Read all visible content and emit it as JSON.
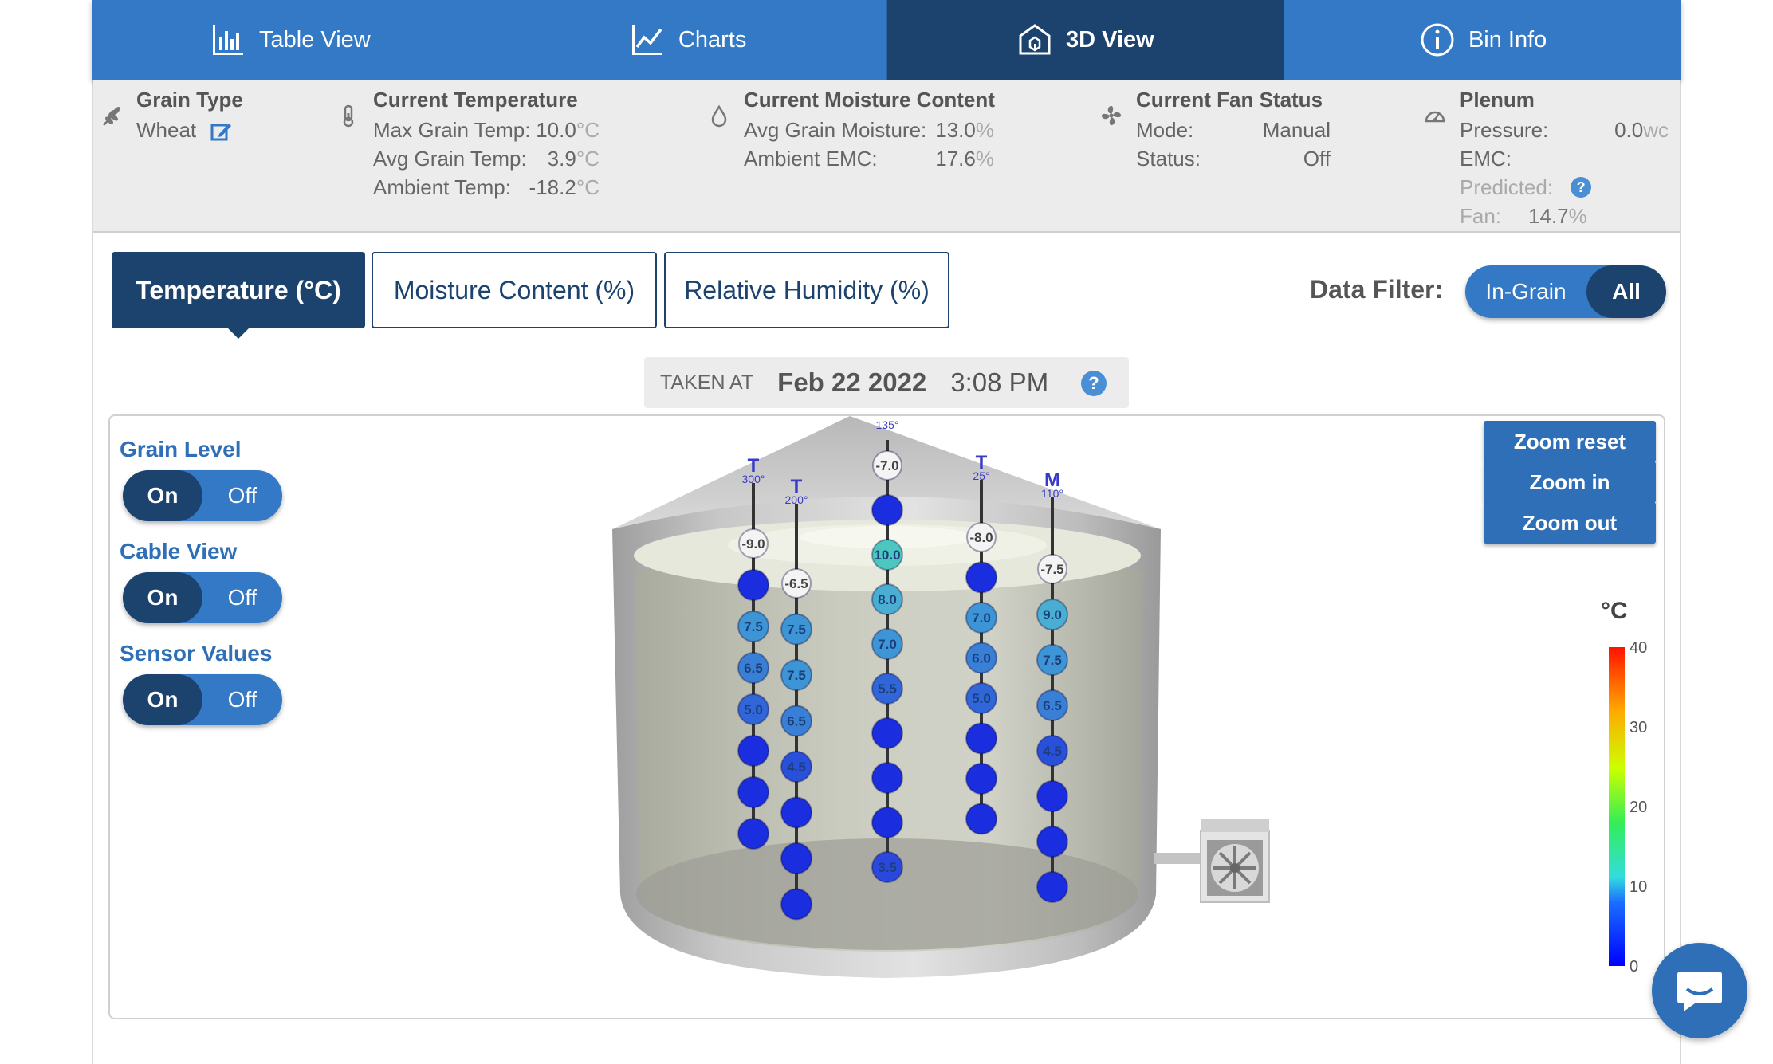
{
  "nav": [
    {
      "label": "Table View",
      "icon": "bar-chart-icon"
    },
    {
      "label": "Charts",
      "icon": "line-chart-icon"
    },
    {
      "label": "3D View",
      "icon": "bin-3d-icon",
      "active": true
    },
    {
      "label": "Bin Info",
      "icon": "info-icon"
    }
  ],
  "info": {
    "grain": {
      "title": "Grain Type",
      "value": "Wheat"
    },
    "temperature": {
      "title": "Current Temperature",
      "rows": [
        {
          "label": "Max Grain Temp:",
          "value": "10.0",
          "unit": "°C"
        },
        {
          "label": "Avg Grain Temp:",
          "value": "3.9",
          "unit": "°C"
        },
        {
          "label": "Ambient Temp:",
          "value": "-18.2",
          "unit": "°C"
        }
      ]
    },
    "moisture": {
      "title": "Current Moisture Content",
      "rows": [
        {
          "label": "Avg Grain Moisture:",
          "value": "13.0",
          "unit": "%"
        },
        {
          "label": "Ambient EMC:",
          "value": "17.6",
          "unit": "%"
        }
      ]
    },
    "fan": {
      "title": "Current Fan Status",
      "rows": [
        {
          "label": "Mode:",
          "value": "Manual"
        },
        {
          "label": "Status:",
          "value": "Off"
        }
      ]
    },
    "plenum": {
      "title": "Plenum",
      "pressure_label": "Pressure:",
      "pressure_value": "0.0",
      "pressure_unit": "wc",
      "emc_label": "EMC:",
      "predicted_label": "Predicted:",
      "fan_label": "Fan:",
      "fan_value": "14.7",
      "fan_unit": "%"
    }
  },
  "tabs": [
    {
      "label": "Temperature (°C)",
      "active": true
    },
    {
      "label": "Moisture Content (%)"
    },
    {
      "label": "Relative Humidity (%)"
    }
  ],
  "filter": {
    "label": "Data Filter:",
    "options": [
      "In-Grain",
      "All"
    ],
    "selected": "All"
  },
  "taken": {
    "label": "TAKEN AT",
    "date": "Feb 22 2022",
    "time": "3:08 PM",
    "help": "?"
  },
  "toggles": [
    {
      "label": "Grain Level",
      "on": "On",
      "off": "Off"
    },
    {
      "label": "Cable View",
      "on": "On",
      "off": "Off"
    },
    {
      "label": "Sensor Values",
      "on": "On",
      "off": "Off"
    }
  ],
  "zoom": {
    "reset": "Zoom reset",
    "in": "Zoom in",
    "out": "Zoom out"
  },
  "legend": {
    "unit": "°C",
    "ticks": [
      "40",
      "30",
      "20",
      "10",
      "0"
    ]
  },
  "colors": {
    "primary": "#3479c6",
    "dark": "#1b436e",
    "accent": "#2f6fb7"
  },
  "cables": [
    {
      "type": "T",
      "angle": "300°",
      "sensors": [
        "-9.0",
        "",
        "7.5",
        "6.5",
        "5.0",
        "",
        "",
        ""
      ]
    },
    {
      "type": "T",
      "angle": "200°",
      "sensors": [
        "-6.5",
        "7.5",
        "7.5",
        "6.5",
        "4.5",
        "",
        "",
        ""
      ]
    },
    {
      "type": "",
      "angle": "135°",
      "sensors": [
        "-7.0",
        "",
        "10.0",
        "8.0",
        "7.0",
        "5.5",
        "",
        "",
        "",
        "3.5"
      ]
    },
    {
      "type": "T",
      "angle": "25°",
      "sensors": [
        "-8.0",
        "",
        "7.0",
        "6.0",
        "5.0",
        "",
        "",
        ""
      ]
    },
    {
      "type": "M",
      "angle": "110°",
      "sensors": [
        "-7.5",
        "9.0",
        "7.5",
        "6.5",
        "4.5",
        "",
        "",
        ""
      ]
    }
  ]
}
